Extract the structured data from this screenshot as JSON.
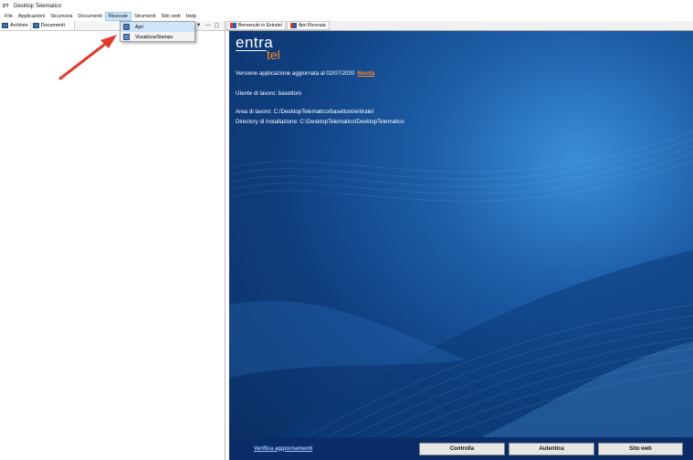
{
  "window": {
    "title": "Desktop Telematico",
    "icon": "app-icon",
    "icon_text": "DT"
  },
  "menubar": {
    "items": [
      "File",
      "Applicazioni",
      "Sicurezza",
      "Documenti",
      "Ricevute",
      "Strumenti",
      "Sito web",
      "Help"
    ],
    "active": "Ricevute"
  },
  "left_pane": {
    "tabs": [
      {
        "label": "Archivio",
        "icon": "archive-icon"
      },
      {
        "label": "Documenti",
        "icon": "documents-icon"
      }
    ],
    "controls": [
      "▼",
      "—",
      "☐"
    ]
  },
  "dropdown": {
    "items": [
      {
        "label": "Apri",
        "icon": "open-icon",
        "hover": true
      },
      {
        "label": "Visualizza/Stampa",
        "icon": "print-icon",
        "hover": false
      }
    ]
  },
  "right_pane": {
    "tabs": [
      {
        "label": "Benvenuto in Entratel",
        "icon": "entratel-icon"
      },
      {
        "label": "Apri Ricevuta",
        "icon": "entratel-icon"
      }
    ],
    "logo": {
      "line1": "entra",
      "line2": "tel"
    },
    "version_text": "Versione applicazione aggiornata al 02/07/2020",
    "novita": "Novità",
    "user_text": "Utente di lavoro: basettoni",
    "area_text": "Area di lavoro: C:/DesktopTelematico/basettoni/entratel",
    "install_dir_text": "Directory di installazione: C:\\DesktopTelematico\\DesktopTelematico",
    "footer": {
      "link": "Verifica aggiornamenti",
      "buttons": [
        "Controlla",
        "Autentica",
        "Sito web"
      ]
    }
  },
  "colors": {
    "accent_orange": "#ff8a1e",
    "background_blue": "#1d5ea8",
    "annotation_arrow": "#e23b2e"
  }
}
